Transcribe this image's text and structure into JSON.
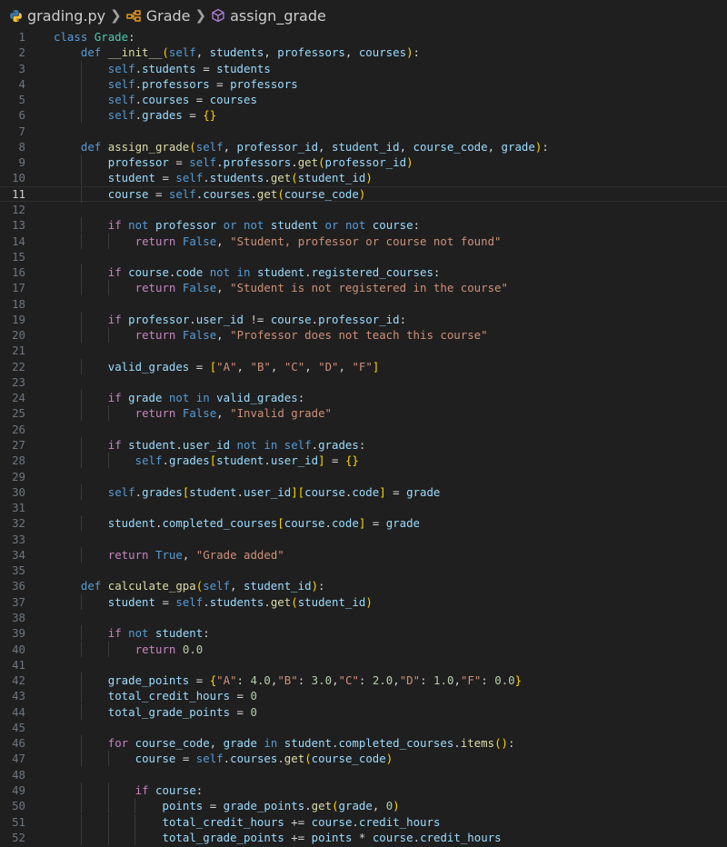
{
  "breadcrumb": {
    "file": "grading.py",
    "class": "Grade",
    "method": "assign_grade"
  },
  "editor": {
    "current_line": 11,
    "lines": [
      "class Grade:",
      "    def __init__(self, students, professors, courses):",
      "        self.students = students",
      "        self.professors = professors",
      "        self.courses = courses",
      "        self.grades = {}",
      "",
      "    def assign_grade(self, professor_id, student_id, course_code, grade):",
      "        professor = self.professors.get(professor_id)",
      "        student = self.students.get(student_id)",
      "        course = self.courses.get(course_code)",
      "",
      "        if not professor or not student or not course:",
      "            return False, \"Student, professor or course not found\"",
      "",
      "        if course.code not in student.registered_courses:",
      "            return False, \"Student is not registered in the course\"",
      "",
      "        if professor.user_id != course.professor_id:",
      "            return False, \"Professor does not teach this course\"",
      "",
      "        valid_grades = [\"A\", \"B\", \"C\", \"D\", \"F\"]",
      "",
      "        if grade not in valid_grades:",
      "            return False, \"Invalid grade\"",
      "",
      "        if student.user_id not in self.grades:",
      "            self.grades[student.user_id] = {}",
      "",
      "        self.grades[student.user_id][course.code] = grade",
      "",
      "        student.completed_courses[course.code] = grade",
      "",
      "        return True, \"Grade added\"",
      "",
      "    def calculate_gpa(self, student_id):",
      "        student = self.students.get(student_id)",
      "",
      "        if not student:",
      "            return 0.0",
      "",
      "        grade_points = {\"A\": 4.0,\"B\": 3.0,\"C\": 2.0,\"D\": 1.0,\"F\": 0.0}",
      "        total_credit_hours = 0",
      "        total_grade_points = 0",
      "",
      "        for course_code, grade in student.completed_courses.items():",
      "            course = self.courses.get(course_code)",
      "",
      "            if course:",
      "                points = grade_points.get(grade, 0)",
      "                total_credit_hours += course.credit_hours",
      "                total_grade_points += points * course.credit_hours",
      ""
    ]
  }
}
